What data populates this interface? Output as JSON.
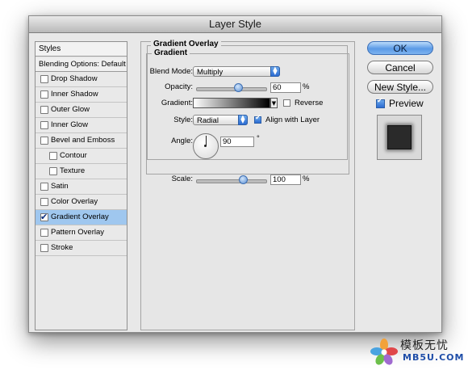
{
  "window": {
    "title": "Layer Style"
  },
  "styles_panel": {
    "header": "Styles",
    "blending": "Blending Options: Default",
    "items": [
      {
        "label": "Drop Shadow",
        "checked": false,
        "indent": false,
        "selected": false
      },
      {
        "label": "Inner Shadow",
        "checked": false,
        "indent": false,
        "selected": false
      },
      {
        "label": "Outer Glow",
        "checked": false,
        "indent": false,
        "selected": false
      },
      {
        "label": "Inner Glow",
        "checked": false,
        "indent": false,
        "selected": false
      },
      {
        "label": "Bevel and Emboss",
        "checked": false,
        "indent": false,
        "selected": false
      },
      {
        "label": "Contour",
        "checked": false,
        "indent": true,
        "selected": false
      },
      {
        "label": "Texture",
        "checked": false,
        "indent": true,
        "selected": false
      },
      {
        "label": "Satin",
        "checked": false,
        "indent": false,
        "selected": false
      },
      {
        "label": "Color Overlay",
        "checked": false,
        "indent": false,
        "selected": false
      },
      {
        "label": "Gradient Overlay",
        "checked": true,
        "indent": false,
        "selected": true
      },
      {
        "label": "Pattern Overlay",
        "checked": false,
        "indent": false,
        "selected": false
      },
      {
        "label": "Stroke",
        "checked": false,
        "indent": false,
        "selected": false
      }
    ]
  },
  "gradient_overlay": {
    "section_title": "Gradient Overlay",
    "group_title": "Gradient",
    "blend_mode_label": "Blend Mode:",
    "blend_mode_value": "Multiply",
    "opacity_label": "Opacity:",
    "opacity_value": "60",
    "opacity_unit": "%",
    "opacity_level": 0.6,
    "gradient_label": "Gradient:",
    "gradient_colors": [
      "#ffffff",
      "#000000"
    ],
    "reverse_label": "Reverse",
    "reverse_checked": false,
    "style_label": "Style:",
    "style_value": "Radial",
    "align_label": "Align with Layer",
    "align_checked": true,
    "angle_label": "Angle:",
    "angle_value": "90",
    "angle_unit": "°",
    "scale_label": "Scale:",
    "scale_value": "100",
    "scale_unit": "%",
    "scale_level": 0.67
  },
  "buttons": {
    "ok": "OK",
    "cancel": "Cancel",
    "new_style": "New Style..."
  },
  "preview": {
    "label": "Preview",
    "checked": true
  },
  "watermark": {
    "line1": "模板无忧",
    "line2": "MB5U.COM"
  },
  "colors": {
    "accent": "#2c6cd2",
    "selection": "#9fc7ef"
  }
}
